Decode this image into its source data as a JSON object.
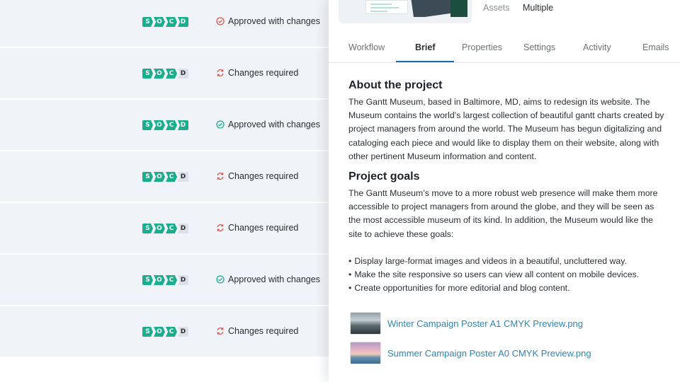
{
  "table": {
    "rows": [
      {
        "stages": [
          "S",
          "O",
          "C",
          "D"
        ],
        "stages_done": 4,
        "status": "Approved with changes",
        "status_type": "approved-red"
      },
      {
        "stages": [
          "S",
          "O",
          "C",
          "D"
        ],
        "stages_done": 3,
        "status": "Changes required",
        "status_type": "changes"
      },
      {
        "stages": [
          "S",
          "O",
          "C",
          "D"
        ],
        "stages_done": 4,
        "status": "Approved with changes",
        "status_type": "approved"
      },
      {
        "stages": [
          "S",
          "O",
          "C",
          "D"
        ],
        "stages_done": 3,
        "status": "Changes required",
        "status_type": "changes"
      },
      {
        "stages": [
          "S",
          "O",
          "C",
          "D"
        ],
        "stages_done": 3,
        "status": "Changes required",
        "status_type": "changes"
      },
      {
        "stages": [
          "S",
          "O",
          "C",
          "D"
        ],
        "stages_done": 3,
        "status": "Approved with changes",
        "status_type": "approved"
      },
      {
        "stages": [
          "S",
          "O",
          "C",
          "D"
        ],
        "stages_done": 3,
        "status": "Changes required",
        "status_type": "changes"
      }
    ]
  },
  "panel": {
    "meta": {
      "label": "Assets",
      "value": "Multiple"
    },
    "tabs": [
      "Workflow",
      "Brief",
      "Properties",
      "Settings",
      "Activity",
      "Emails"
    ],
    "active_tab": "Brief",
    "about_title": "About the project",
    "about_text": "The Gantt Museum, based in Baltimore, MD, aims to redesign its website. The Museum contains the world’s largest collection of beautiful gantt charts created by project managers from around the world. The Museum has begun digitalizing and cataloging each piece and would like to display them on their website, along with other pertinent Museum information and content.",
    "goals_title": "Project goals",
    "goals_text": "The Gantt Museum’s move to a more robust web presence will make them more accessible to project managers from around the globe, and they will be seen as the most accessible museum of its kind. In addition, the Museum would like the site to achieve these goals:",
    "goals": [
      "Display large-format images and videos in a beautiful, uncluttered way.",
      "Make the site responsive so users can view all content on mobile devices.",
      "Create opportunities for more editorial and blog content."
    ],
    "attachments": [
      {
        "name": "Winter Campaign Poster A1 CMYK Preview.png"
      },
      {
        "name": "Summer Campaign Poster A0 CMYK Preview.png"
      }
    ]
  },
  "colors": {
    "stage_done": "#1aae8f",
    "stage_pending": "#dde1e7",
    "approved_green": "#1aae8f",
    "changes_red": "#e0574f",
    "link_blue": "#2f86b4",
    "tab_underline": "#1f6fa8"
  }
}
